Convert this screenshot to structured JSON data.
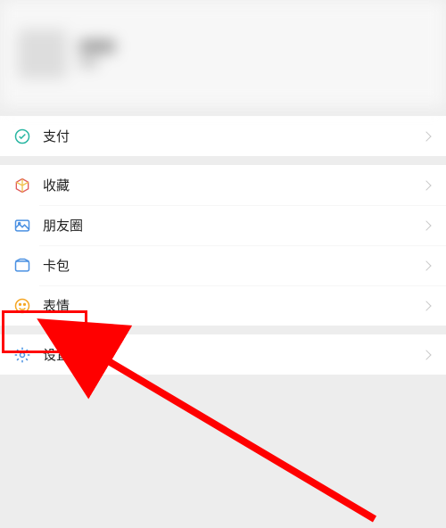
{
  "menu": {
    "section1": [
      {
        "key": "pay",
        "label": "支付"
      }
    ],
    "section2": [
      {
        "key": "favorites",
        "label": "收藏"
      },
      {
        "key": "moments",
        "label": "朋友圈"
      },
      {
        "key": "cards",
        "label": "卡包"
      },
      {
        "key": "stickers",
        "label": "表情"
      }
    ],
    "section3": [
      {
        "key": "settings",
        "label": "设置"
      }
    ]
  }
}
